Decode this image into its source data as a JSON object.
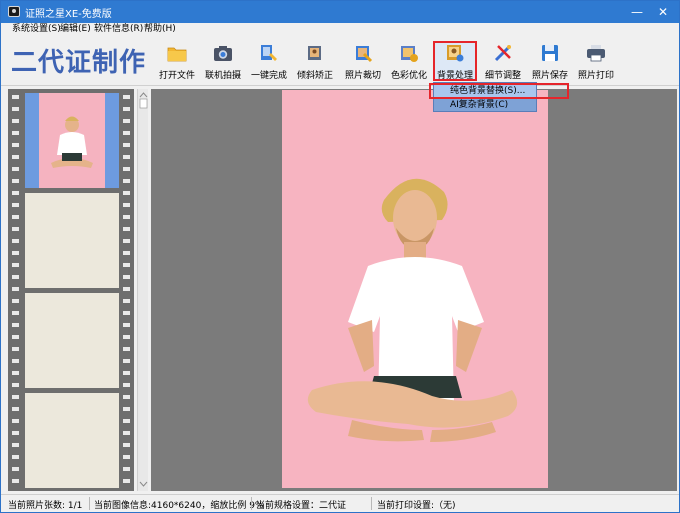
{
  "window": {
    "title": "证照之星XE-免费版",
    "minimize": "—",
    "close": "✕"
  },
  "menu": [
    {
      "label": "系统设置(S)"
    },
    {
      "label": "编辑(E)"
    },
    {
      "label": "软件信息(R)"
    },
    {
      "label": "帮助(H)"
    }
  ],
  "toolbar": {
    "brand": "二代证制作",
    "tools": [
      {
        "label": "打开文件",
        "icon": "folder-icon",
        "color": "#f2b632"
      },
      {
        "label": "联机拍摄",
        "icon": "camera-icon",
        "color": "#4a5366"
      },
      {
        "label": "一键完成",
        "icon": "magic-icon",
        "color": "#3b7dd8"
      },
      {
        "label": "倾斜矫正",
        "icon": "rotate-icon",
        "color": "#d08a3a"
      },
      {
        "label": "照片裁切",
        "icon": "crop-icon",
        "color": "#e4a31c"
      },
      {
        "label": "色彩优化",
        "icon": "color-icon",
        "color": "#5a7fc8"
      },
      {
        "label": "背景处理",
        "icon": "background-icon",
        "color": "#d89b2a"
      },
      {
        "label": "细节调整",
        "icon": "brush-icon",
        "color": "#3b6fd2"
      },
      {
        "label": "照片保存",
        "icon": "save-icon",
        "color": "#2f7ad1"
      },
      {
        "label": "照片打印",
        "icon": "printer-icon",
        "color": "#4b5a72"
      }
    ]
  },
  "dropdown": {
    "items": [
      {
        "label": "纯色背景替换(S)..."
      },
      {
        "label": "AI复杂背景(C)"
      }
    ]
  },
  "statusbar": {
    "count": "当前照片张数: 1/1",
    "image_info": "当前图像信息:4160*6240，缩放比例 9%",
    "spec": "当前规格设置：二代证",
    "print": "当前打印设置:（无)"
  },
  "colors": {
    "titlebar": "#2f7ad1",
    "brand": "#3e63b3",
    "highlight": "#e5252b",
    "photo_bg": "#f7b4c1"
  }
}
